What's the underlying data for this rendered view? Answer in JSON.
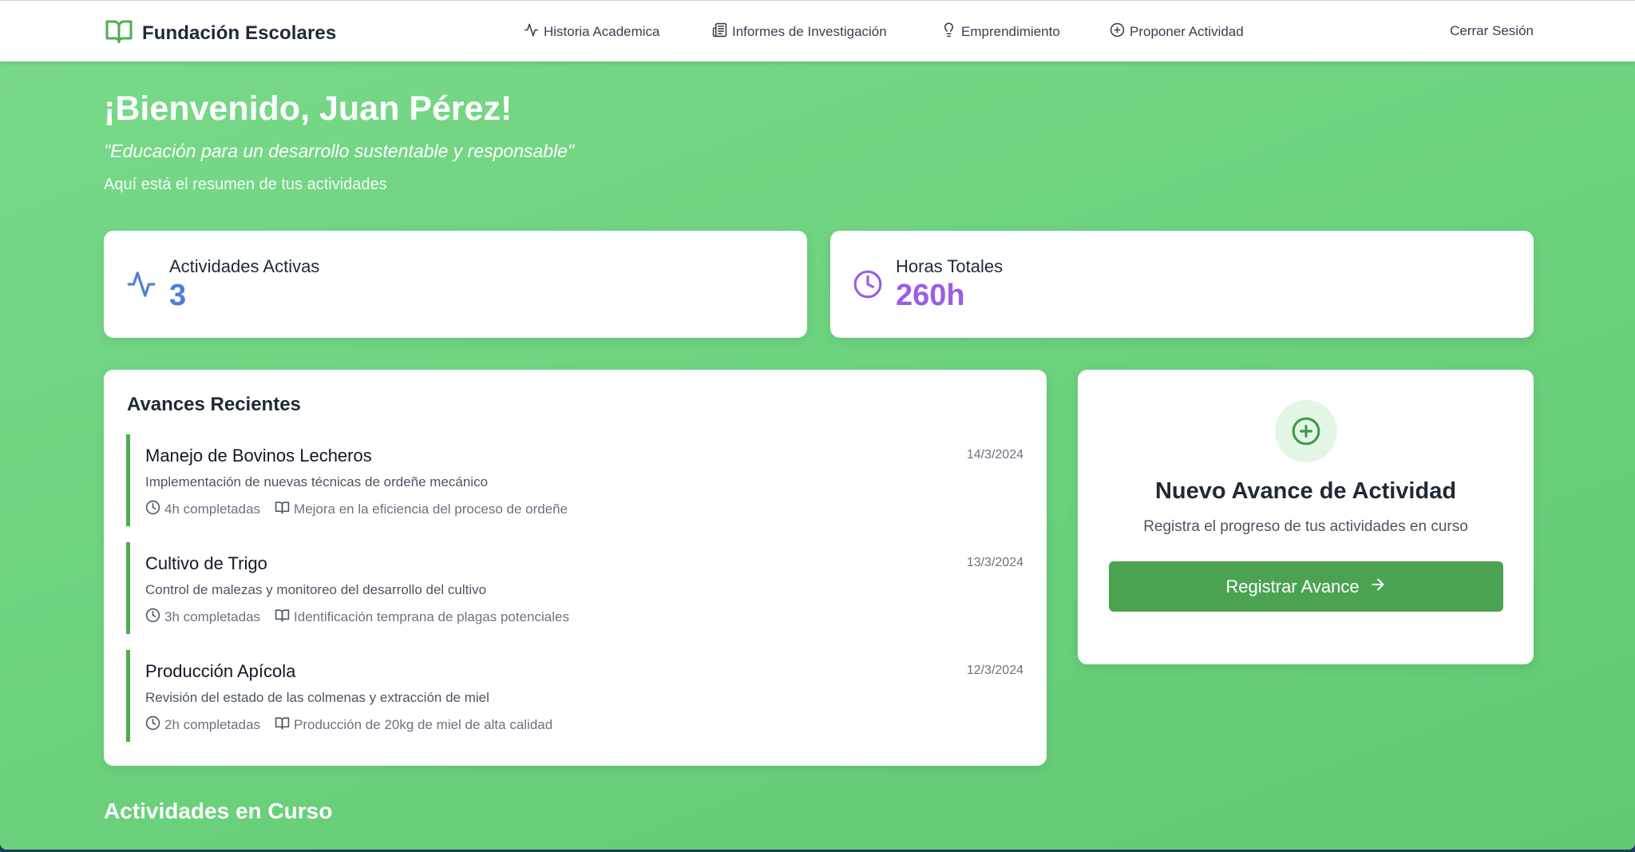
{
  "navbar": {
    "brand": "Fundación Escolares",
    "items": [
      {
        "label": "Historia Academica",
        "icon": "activity-icon"
      },
      {
        "label": "Informes de Investigación",
        "icon": "newspaper-icon"
      },
      {
        "label": "Emprendimiento",
        "icon": "lightbulb-icon"
      },
      {
        "label": "Proponer Actividad",
        "icon": "plus-circle-icon"
      }
    ],
    "logout": "Cerrar Sesión"
  },
  "header": {
    "welcome": "¡Bienvenido, Juan Pérez!",
    "motto": "\"Educación para un desarrollo sustentable y responsable\"",
    "intro": "Aquí está el resumen de tus actividades"
  },
  "stats": [
    {
      "title": "Actividades Activas",
      "value": "3",
      "color": "#4f7ed8",
      "icon": "activity-icon"
    },
    {
      "title": "Horas Totales",
      "value": "260h",
      "color": "#9b5de5",
      "icon": "clock-icon"
    }
  ],
  "recent": {
    "title": "Avances Recientes",
    "entries": [
      {
        "title": "Manejo de Bovinos Lecheros",
        "date": "14/3/2024",
        "description": "Implementación de nuevas técnicas de ordeñe mecánico",
        "hours": "4h completadas",
        "result": "Mejora en la eficiencia del proceso de ordeñe"
      },
      {
        "title": "Cultivo de Trigo",
        "date": "13/3/2024",
        "description": "Control de malezas y monitoreo del desarrollo del cultivo",
        "hours": "3h completadas",
        "result": "Identificación temprana de plagas potenciales"
      },
      {
        "title": "Producción Apícola",
        "date": "12/3/2024",
        "description": "Revisión del estado de las colmenas y extracción de miel",
        "hours": "2h completadas",
        "result": "Producción de 20kg de miel de alta calidad"
      }
    ]
  },
  "new_activity": {
    "title": "Nuevo Avance de Actividad",
    "subtitle": "Registra el progreso de tus actividades en curso",
    "button": "Registrar Avance"
  },
  "ongoing": {
    "title": "Actividades en Curso"
  },
  "colors": {
    "accent": "#4ba352",
    "brand_green": "#4caf50",
    "stat_blue": "#4f7ed8",
    "stat_purple": "#9b5de5"
  }
}
